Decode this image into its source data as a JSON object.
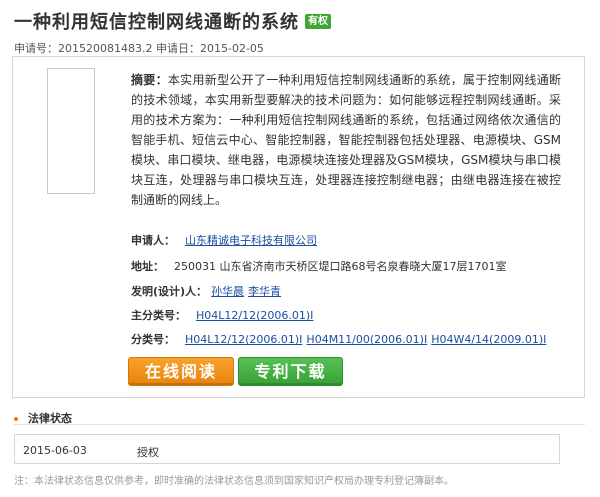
{
  "header": {
    "title": "一种利用短信控制网线通断的系统",
    "badge": "有权",
    "app_no_label": "申请号：",
    "app_no": "201520081483.2",
    "app_date_label": "申请日：",
    "app_date": "2015-02-05"
  },
  "abstract": {
    "label": "摘要：",
    "text": "本实用新型公开了一种利用短信控制网线通断的系统，属于控制网线通断的技术领域，本实用新型要解决的技术问题为：如何能够远程控制网线通断。采用的技术方案为：一种利用短信控制网线通断的系统，包括通过网络依次通信的智能手机、短信云中心、智能控制器，智能控制器包括处理器、电源模块、GSM模块、串口模块、继电器，电源模块连接处理器及GSM模块，GSM模块与串口模块互连，处理器与串口模块互连，处理器连接控制继电器；由继电器连接在被控制通断的网线上。"
  },
  "fields": {
    "applicant_label": "申请人：",
    "applicant": "山东精诚电子科技有限公司",
    "address_label": "地址：",
    "address": "250031 山东省济南市天桥区堤口路68号名泉春晓大厦17层1701室",
    "inventors_label": "发明(设计)人：",
    "inventors": [
      "孙华晨",
      "李华青"
    ],
    "main_class_label": "主分类号：",
    "main_class": "H04L12/12(2006.01)I",
    "classes_label": "分类号：",
    "classes": [
      "H04L12/12(2006.01)I",
      "H04M11/00(2006.01)I",
      "H04W4/14(2009.01)I"
    ]
  },
  "buttons": {
    "read_online": "在线阅读",
    "download": "专利下载"
  },
  "legal": {
    "heading": "法律状态",
    "date": "2015-06-03",
    "status": "授权",
    "note": "注：本法律状态信息仅供参考，即时准确的法律状态信息须到国家知识产权局办理专利登记簿副本。"
  },
  "colors": {
    "badge": "#3fa535",
    "link": "#1a4fa0",
    "read_button": "#f39219",
    "download_button": "#45b143"
  }
}
